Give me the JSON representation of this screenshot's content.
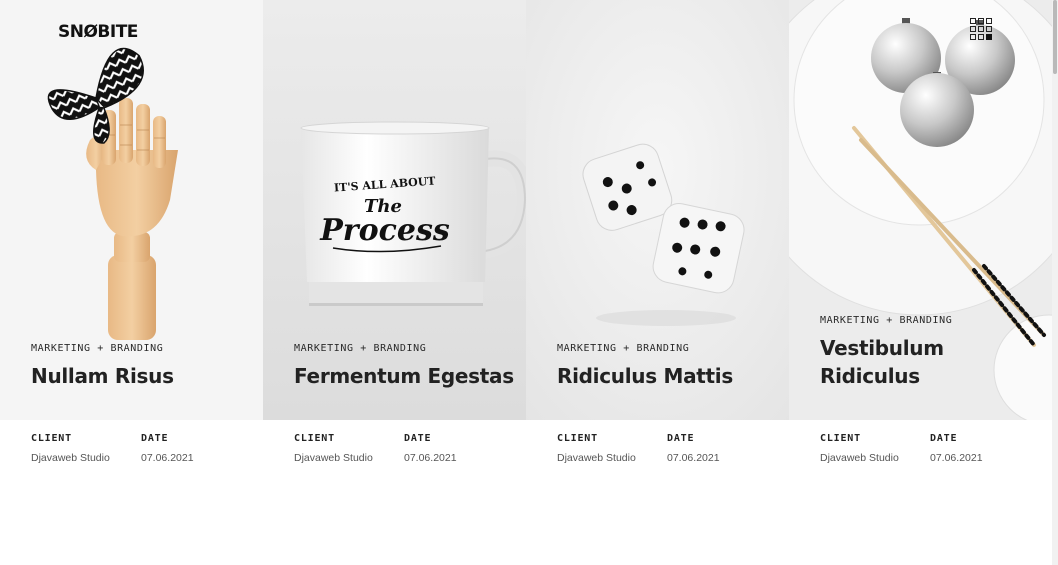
{
  "brand": {
    "logo_text": "SNØBITE"
  },
  "header": {
    "menu_icon": "grid-menu-icon"
  },
  "meta_labels": {
    "client": "CLIENT",
    "date": "DATE"
  },
  "projects": [
    {
      "category": "MARKETING + BRANDING",
      "title": "Nullam Risus",
      "client": "Djavaweb Studio",
      "date": "07.06.2021",
      "image": "wooden-hand-butterfly"
    },
    {
      "category": "MARKETING + BRANDING",
      "title": "Fermentum Egestas",
      "client": "Djavaweb Studio",
      "date": "07.06.2021",
      "image": "process-mug",
      "mug_text": {
        "line1": "IT'S ALL ABOUT",
        "line2": "The",
        "line3": "Process"
      }
    },
    {
      "category": "MARKETING + BRANDING",
      "title": "Ridiculus Mattis",
      "client": "Djavaweb Studio",
      "date": "07.06.2021",
      "image": "dice"
    },
    {
      "category": "MARKETING + BRANDING",
      "title": "Vestibulum Ridiculus",
      "client": "Djavaweb Studio",
      "date": "07.06.2021",
      "image": "plate-ornaments-chopsticks"
    }
  ]
}
